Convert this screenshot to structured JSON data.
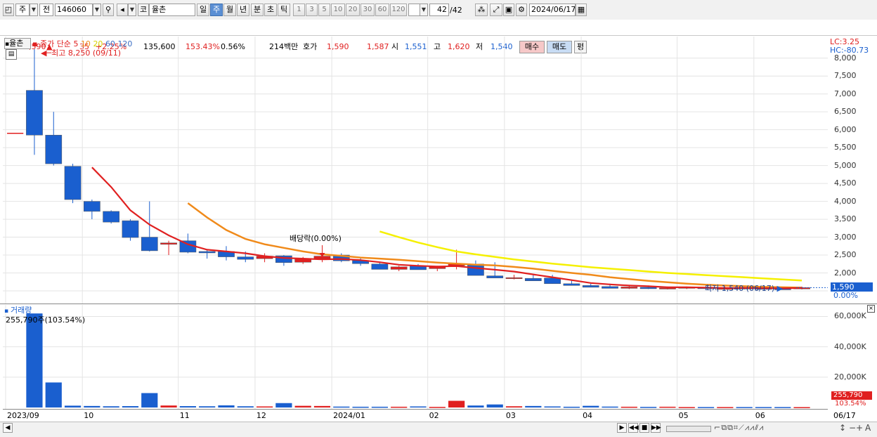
{
  "toolbar": {
    "period_type": "주",
    "prev_label": "전",
    "stock_code": "146060",
    "market_tag": "코",
    "stock_name": "율촌",
    "periods": [
      "일",
      "주",
      "월",
      "년",
      "분",
      "초",
      "틱"
    ],
    "selected_period": "주",
    "intervals": [
      "1",
      "3",
      "5",
      "10",
      "20",
      "30",
      "60",
      "120"
    ],
    "count": "42",
    "count_total": "/42",
    "date": "2024/06/17"
  },
  "quote": {
    "price": "1,590",
    "change_arrow": "▲",
    "change": "35",
    "change_pct": "+2.25%",
    "volume": "135,600",
    "volume_ratio": "153.43%",
    "turnover": "0.56%",
    "amount": "214백만",
    "hoga_label": "호가",
    "hoga_sell": "1,590",
    "hoga_buy": "1,587",
    "open_label": "시",
    "open": "1,551",
    "high_label": "고",
    "high": "1,620",
    "low_label": "저",
    "low": "1,540",
    "buy_button": "매수",
    "sell_button": "매도",
    "avg_button": "평"
  },
  "price_panel": {
    "name_tag": "율촌",
    "ma_label": "종가 단순",
    "ma_periods": [
      "5",
      "10",
      "20",
      "60",
      "120"
    ],
    "ma_colors": [
      "#e02020",
      "#f08a1a",
      "#e8e800",
      "#3b6dc4",
      "#3b6dc4"
    ],
    "max_marker": "최고 8,250 (09/11)",
    "min_marker": "최저 1,540 (06/17)",
    "dividend_marker": "배당락(0.00%)",
    "lc": "LC:3.25",
    "hc": "HC:-80.73",
    "current_price": "1,590",
    "current_pct": "0.00%",
    "y_ticks": [
      "8,000",
      "7,500",
      "7,000",
      "6,500",
      "6,000",
      "5,500",
      "5,000",
      "4,500",
      "4,000",
      "3,500",
      "3,000",
      "2,500",
      "2,000",
      "1,500"
    ]
  },
  "volume_panel": {
    "title": "거래량",
    "info": "255,790주(103.54%)",
    "y_ticks": [
      "60,000K",
      "40,000K",
      "20,000K"
    ],
    "current_value": "255,790",
    "current_pct": "103.54%"
  },
  "x_axis": {
    "labels": [
      "2023/09",
      "10",
      "11",
      "12",
      "2024/01",
      "02",
      "03",
      "04",
      "05",
      "06"
    ],
    "end_label": "06/17"
  },
  "colors": {
    "up": "#e02020",
    "down": "#1a5fcf",
    "ma5": "#e02020",
    "ma10": "#f08a1a",
    "ma20": "#f5f000",
    "axis_tag": "#1a5fcf"
  },
  "chart_data": {
    "type": "candlestick",
    "categories": [
      "2023/09-1",
      "2023/09-2",
      "2023/09-3",
      "2023/10-1",
      "2023/10-2",
      "2023/10-3",
      "2023/10-4",
      "2023/10-5",
      "2023/11-1",
      "2023/11-2",
      "2023/11-3",
      "2023/11-4",
      "2023/12-1",
      "2023/12-2",
      "2023/12-3",
      "2023/12-4",
      "2024/01-1",
      "2024/01-2",
      "2024/01-3",
      "2024/01-4",
      "2024/02-1",
      "2024/02-2",
      "2024/02-3",
      "2024/02-4",
      "2024/03-1",
      "2024/03-2",
      "2024/03-3",
      "2024/03-4",
      "2024/04-1",
      "2024/04-2",
      "2024/04-3",
      "2024/04-4",
      "2024/05-1",
      "2024/05-2",
      "2024/05-3",
      "2024/05-4",
      "2024/06-1",
      "2024/06-2",
      "2024/06-3",
      "2024/06-4",
      "2024/06-5",
      "2024/06-6"
    ],
    "open": [
      5900,
      7100,
      5850,
      4980,
      4000,
      3720,
      3460,
      3000,
      2800,
      2900,
      2600,
      2600,
      2450,
      2400,
      2480,
      2300,
      2400,
      2500,
      2350,
      2250,
      2100,
      2200,
      2120,
      2200,
      2250,
      1920,
      1860,
      1850,
      1860,
      1700,
      1650,
      1620,
      1570,
      1600,
      1560,
      1580,
      1590,
      1560,
      1580,
      1570,
      1560,
      1555
    ],
    "high": [
      5900,
      8250,
      6500,
      5050,
      4050,
      3750,
      3500,
      4000,
      2900,
      3100,
      2650,
      2750,
      2600,
      2550,
      2500,
      2450,
      2500,
      2550,
      2450,
      2300,
      2200,
      2250,
      2200,
      2650,
      2350,
      2300,
      1950,
      1950,
      1950,
      1800,
      1700,
      1700,
      1650,
      1650,
      1620,
      1620,
      1640,
      1620,
      1620,
      1600,
      1600,
      1620
    ],
    "low": [
      5900,
      5300,
      5000,
      3950,
      3500,
      3380,
      2900,
      2600,
      2500,
      2550,
      2400,
      2350,
      2300,
      2300,
      2200,
      2250,
      2300,
      2300,
      2200,
      2100,
      2050,
      2100,
      2050,
      2100,
      2100,
      1900,
      1820,
      1800,
      1700,
      1650,
      1600,
      1580,
      1550,
      1550,
      1540,
      1550,
      1540,
      1540,
      1540,
      1540,
      1540,
      1540
    ],
    "close": [
      5900,
      5850,
      5050,
      4050,
      3720,
      3420,
      2990,
      2620,
      2840,
      2580,
      2560,
      2450,
      2380,
      2470,
      2290,
      2400,
      2470,
      2340,
      2260,
      2100,
      2170,
      2090,
      2180,
      2260,
      1930,
      1860,
      1870,
      1780,
      1700,
      1650,
      1600,
      1570,
      1610,
      1560,
      1580,
      1600,
      1560,
      1570,
      1570,
      1560,
      1555,
      1590
    ],
    "volume": [
      0,
      62000,
      16500,
      1200,
      1000,
      800,
      900,
      9500,
      1300,
      900,
      800,
      1400,
      800,
      700,
      2900,
      1100,
      1000,
      600,
      500,
      500,
      500,
      700,
      400,
      4400,
      1300,
      2000,
      800,
      1000,
      700,
      500,
      1100,
      600,
      500,
      400,
      500,
      300,
      300,
      300,
      300,
      300,
      300,
      260
    ],
    "ma5": [
      null,
      null,
      null,
      null,
      4950,
      4400,
      3750,
      3350,
      3050,
      2800,
      2650,
      2600,
      2550,
      2470,
      2420,
      2400,
      2380,
      2390,
      2360,
      2300,
      2230,
      2200,
      2180,
      2190,
      2140,
      2090,
      2040,
      1960,
      1880,
      1800,
      1720,
      1680,
      1650,
      1630,
      1600,
      1600,
      1590,
      1580,
      1580,
      1575,
      1570,
      1580
    ],
    "ma10": [
      null,
      null,
      null,
      null,
      null,
      null,
      null,
      null,
      null,
      3950,
      3550,
      3200,
      2950,
      2800,
      2700,
      2600,
      2520,
      2480,
      2430,
      2400,
      2370,
      2330,
      2290,
      2260,
      2230,
      2210,
      2170,
      2120,
      2060,
      2000,
      1950,
      1880,
      1830,
      1780,
      1740,
      1700,
      1670,
      1650,
      1630,
      1610,
      1600,
      1590
    ],
    "ma20": [
      null,
      null,
      null,
      null,
      null,
      null,
      null,
      null,
      null,
      null,
      null,
      null,
      null,
      null,
      null,
      null,
      null,
      null,
      null,
      3160,
      3000,
      2850,
      2720,
      2600,
      2520,
      2450,
      2380,
      2320,
      2260,
      2210,
      2160,
      2120,
      2080,
      2040,
      2000,
      1970,
      1940,
      1910,
      1880,
      1850,
      1820,
      1790
    ],
    "ylim": [
      1500,
      8250
    ],
    "volume_ylim": [
      0,
      63000
    ]
  }
}
